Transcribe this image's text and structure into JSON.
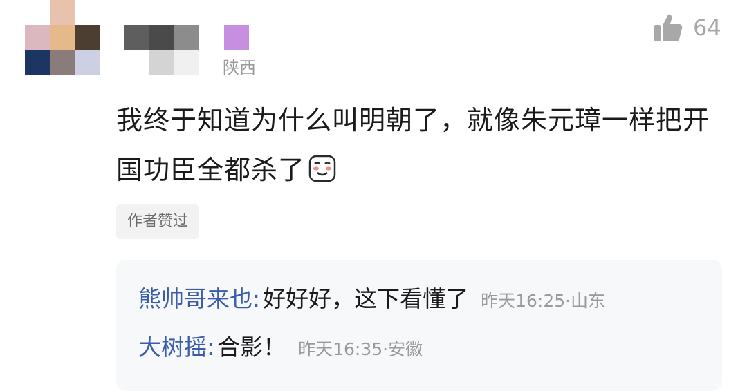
{
  "comment": {
    "location": "陕西",
    "like_count": "64",
    "text": "我终于知道为什么叫明朝了，就像朱元璋一样把开国功臣全都杀了",
    "emoji_icon": "shy-smile-emoji-icon",
    "author_badge": "作者赞过"
  },
  "replies": [
    {
      "name": "熊帅哥来也:",
      "text": "好好好，这下看懂了",
      "meta": "昨天16:25·山东"
    },
    {
      "name": "大树摇:",
      "text": "合影！",
      "meta": "昨天16:35·安徽"
    }
  ],
  "colors": {
    "reply_name": "#3a5cab",
    "meta_gray": "#9a9a9a",
    "reply_bg": "#f7f8fa"
  }
}
